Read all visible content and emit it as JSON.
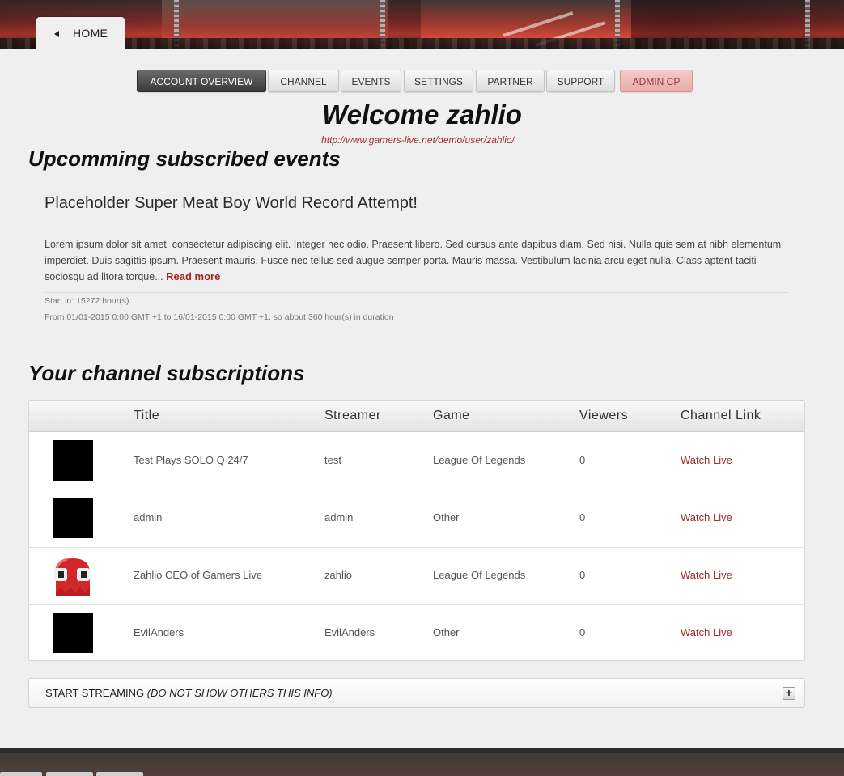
{
  "header": {
    "home_label": "HOME"
  },
  "nav": [
    {
      "label": "ACCOUNT OVERVIEW",
      "state": "active"
    },
    {
      "label": "CHANNEL",
      "state": "default"
    },
    {
      "label": "EVENTS",
      "state": "default"
    },
    {
      "label": "SETTINGS",
      "state": "default"
    },
    {
      "label": "PARTNER",
      "state": "default"
    },
    {
      "label": "SUPPORT",
      "state": "default"
    },
    {
      "label": "ADMIN CP",
      "state": "admin"
    }
  ],
  "welcome": {
    "title": "Welcome zahlio",
    "profile_url": "http://www.gamers-live.net/demo/user/zahlio/"
  },
  "events_section": {
    "heading": "Upcomming subscribed events",
    "event": {
      "title": "Placeholder Super Meat Boy World Record Attempt!",
      "description": "Lorem ipsum dolor sit amet, consectetur adipiscing elit. Integer nec odio. Praesent libero. Sed cursus ante dapibus diam. Sed nisi. Nulla quis sem at nibh elementum imperdiet. Duis sagittis ipsum. Praesent mauris. Fusce nec tellus sed augue semper porta. Mauris massa. Vestibulum lacinia arcu eget nulla. Class aptent taciti sociosqu ad litora torque...",
      "read_more": "Read more",
      "start_in": "Start in: 15272 hour(s).",
      "duration": "From 01/01-2015 0:00 GMT +1 to 16/01-2015 0:00 GMT +1, so about 360 hour(s) in duration"
    }
  },
  "subscriptions_section": {
    "heading": "Your channel subscriptions",
    "columns": [
      "Title",
      "Streamer",
      "Game",
      "Viewers",
      "Channel Link"
    ],
    "rows": [
      {
        "thumb": "black-thumbnail",
        "title": "Test Plays SOLO Q 24/7",
        "streamer": "test",
        "game": "League Of Legends",
        "viewers": "0",
        "link": "Watch Live"
      },
      {
        "thumb": "black-thumbnail",
        "title": "admin",
        "streamer": "admin",
        "game": "Other",
        "viewers": "0",
        "link": "Watch Live"
      },
      {
        "thumb": "red-ghost-avatar",
        "title": "Zahlio CEO of Gamers Live",
        "streamer": "zahlio",
        "game": "League Of Legends",
        "viewers": "0",
        "link": "Watch Live"
      },
      {
        "thumb": "black-thumbnail",
        "title": "EvilAnders",
        "streamer": "EvilAnders",
        "game": "Other",
        "viewers": "0",
        "link": "Watch Live"
      }
    ]
  },
  "streaming": {
    "label": "START STREAMING",
    "note": "(DO NOT SHOW OTHERS THIS INFO)",
    "toggle": "+"
  },
  "colors": {
    "accent_link": "#a02828",
    "admin_button": "#e9aaaa",
    "active_button": "#3a3a3a"
  }
}
